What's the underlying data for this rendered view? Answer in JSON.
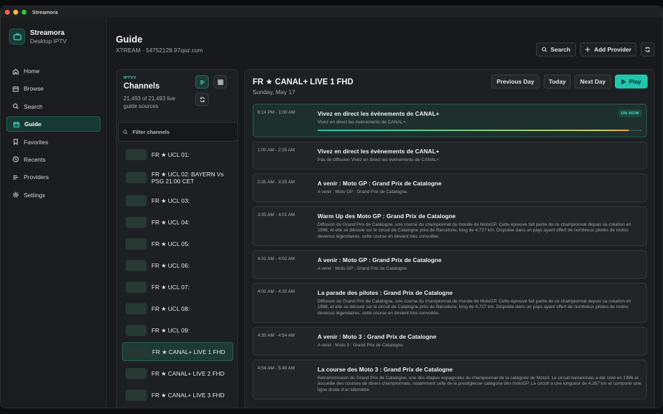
{
  "window": {
    "title": "Streamora"
  },
  "sidebar": {
    "brand_name": "Streamora",
    "brand_sub": "Desktop IPTV",
    "items": [
      {
        "label": "Home",
        "icon": "home-icon"
      },
      {
        "label": "Browse",
        "icon": "browse-icon"
      },
      {
        "label": "Search",
        "icon": "search-icon"
      },
      {
        "label": "Guide",
        "icon": "calendar-icon",
        "active": true
      },
      {
        "label": "Favorites",
        "icon": "bookmark-icon"
      },
      {
        "label": "Recents",
        "icon": "clock-icon"
      },
      {
        "label": "Providers",
        "icon": "list-icon"
      },
      {
        "label": "Settings",
        "icon": "gear-icon"
      }
    ]
  },
  "header": {
    "title": "Guide",
    "subtitle": "XTREAM · 54752128.97qaz.com",
    "search_label": "Search",
    "add_provider_label": "Add Provider"
  },
  "channels": {
    "tag": "IPTVV",
    "title": "Channels",
    "count": "21,493 of 21,493 live guide sources",
    "filter_placeholder": "Filter channels",
    "items": [
      {
        "name": "FR ★ UCL 01:"
      },
      {
        "name": "FR ★ UCL 02: BAYERN Vs PSG 21:00 CET"
      },
      {
        "name": "FR ★ UCL 03:"
      },
      {
        "name": "FR ★ UCL 04:"
      },
      {
        "name": "FR ★ UCL 05:"
      },
      {
        "name": "FR ★ UCL 06:"
      },
      {
        "name": "FR ★ UCL 07:"
      },
      {
        "name": "FR ★ UCL 08:"
      },
      {
        "name": "FR ★ UCL 09:"
      },
      {
        "name": "FR ★ CANAL+ LIVE 1 FHD",
        "active": true
      },
      {
        "name": "FR ★ CANAL+ LIVE 2 FHD"
      },
      {
        "name": "FR ★ CANAL+ LIVE 3 FHD"
      }
    ]
  },
  "guide": {
    "channel_title": "FR ★ CANAL+ LIVE 1 FHD",
    "date": "Sunday, May 17",
    "prev_label": "Previous Day",
    "today_label": "Today",
    "next_label": "Next Day",
    "play_label": "Play",
    "on_now_label": "ON NOW",
    "now_progress": 0.96,
    "programs": [
      {
        "time": "6:14 PM - 1:00 AM",
        "title": "Vivez en direct les évènements de CANAL+",
        "desc": "Vivez en direct les évènements de CANAL+.",
        "now": true
      },
      {
        "time": "1:00 AM - 2:35 AM",
        "title": "Vivez en direct les évènements de CANAL+",
        "desc": "Pas de diffusion Vivez en direct les évènements de CANAL+."
      },
      {
        "time": "2:35 AM - 3:35 AM",
        "title": "A venir : Moto GP : Grand Prix de Catalogne",
        "desc": "A venir : Moto GP : Grand Prix de Catalogne."
      },
      {
        "time": "3:35 AM - 4:01 AM",
        "title": "Warm Up des Moto GP : Grand Prix de Catalogne",
        "desc": "Diffusion du Grand Prix de Catalogne, une course du championnat du monde de MotoGP. Cette épreuve fait partie de ce championnat depuis sa création en 1996, et elle se déroule sur le circuit de Catalogne près de Barcelone, long de 4,727 km. Disputée dans un pays ayant offert de nombreux pilotes de motos devenus légendaires, cette course en devient très convoitée."
      },
      {
        "time": "4:01 AM - 4:02 AM",
        "title": "A venir : Moto GP : Grand Prix de Catalogne",
        "desc": "A venir : Moto GP : Grand Prix de Catalogne."
      },
      {
        "time": "4:02 AM - 4:30 AM",
        "title": "La parade des pilotes : Grand Prix de Catalogne",
        "desc": "Diffusion du Grand Prix de Catalogne, une course du championnat du monde de MotoGP. Cette épreuve fait partie de ce championnat depuis sa création en 1996, et elle se déroule sur le circuit de Catalogne près de Barcelone, long de 4,727 km. Disputée dans un pays ayant offert de nombreux pilotes de motos devenus légendaires, cette course en devient très convoitée."
      },
      {
        "time": "4:30 AM - 4:54 AM",
        "title": "A venir : Moto 3 : Grand Prix de Catalogne",
        "desc": "A venir : Moto 3 : Grand Prix de Catalogne."
      },
      {
        "time": "4:54 AM - 5:49 AM",
        "title": "La course des Moto 3 : Grand Prix de Catalogne",
        "desc": "Retransmission du Grand Prix de Catalogne, une des étapes espagnoles du championnat de la catégorie de Moto3. Le circuit barcelonais a été créé en 1996 et accueille des courses de divers championnats, notamment celle de la prestigieuse catégorie des motoGP. Le circuit a une longueur de 4,267 km et comporte une ligne droite d'un kilomètre."
      }
    ]
  },
  "colors": {
    "accent": "#1fc7ad",
    "background": "#17191b"
  }
}
